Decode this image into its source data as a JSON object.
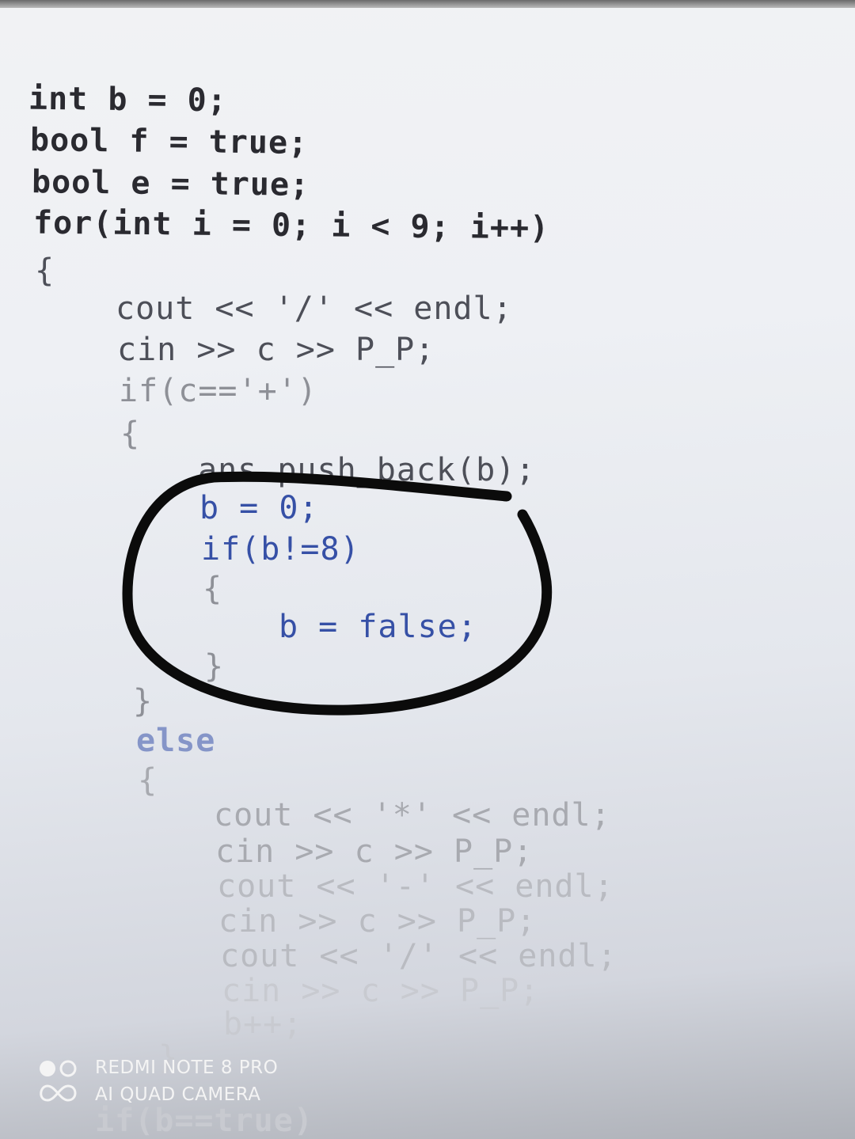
{
  "code": {
    "lines": [
      "int b = 0;",
      "bool f = true;",
      "bool e = true;",
      "for(int i = 0; i < 9; i++)",
      "{",
      "cout << '/' << endl;",
      "cin >> c >> P_P;",
      "if(c=='+')",
      "{",
      "ans.push_back(b);",
      "b = 0;",
      "if(b!=8)",
      "{",
      "b = false;",
      "}",
      "}",
      "else",
      "{",
      "cout << '*' << endl;",
      "cin >> c >> P_P;",
      "cout << '-' << endl;",
      "cin >> c >> P_P;",
      "cout << '/' << endl;",
      "cin >> c >> P_P;",
      "b++;",
      "}",
      "if(b==true)"
    ]
  },
  "watermark": {
    "line1": "REDMI NOTE 8 PRO",
    "line2": "AI QUAD CAMERA"
  },
  "colors": {
    "code_dark": "#2a2a30",
    "code_blue": "#3650a6",
    "ink_circle": "#0b0b0b",
    "watermark_text": "#f4f4f4"
  }
}
